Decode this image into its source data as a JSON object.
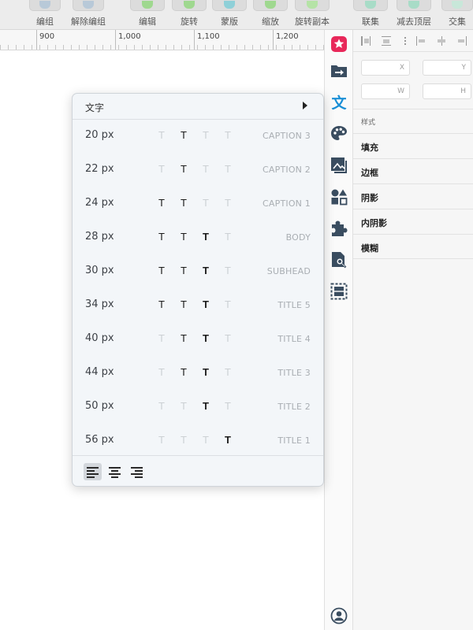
{
  "toolbar": {
    "buttons": [
      {
        "label": "编组",
        "icon": "group-icon"
      },
      {
        "label": "解除编组",
        "icon": "ungroup-icon"
      },
      {
        "label": "编辑",
        "icon": "edit-icon"
      },
      {
        "label": "旋转",
        "icon": "rotate-icon"
      },
      {
        "label": "蒙版",
        "icon": "mask-icon"
      },
      {
        "label": "缩放",
        "icon": "scale-icon"
      },
      {
        "label": "旋转副本",
        "icon": "rotate-copy-icon"
      },
      {
        "label": "联集",
        "icon": "union-icon"
      },
      {
        "label": "减去顶层",
        "icon": "subtract-icon"
      },
      {
        "label": "交集",
        "icon": "intersect-icon"
      }
    ]
  },
  "ruler": {
    "labels": [
      "900",
      "1,000",
      "1,100",
      "1,200"
    ]
  },
  "rail": {
    "icons": [
      "star-badge-icon",
      "folder-arrow-icon",
      "text-wen-icon",
      "palette-icon",
      "image-layers-icon",
      "shapes-icon",
      "puzzle-icon",
      "document-search-icon",
      "selection-frame-icon",
      "user-avatar-icon"
    ],
    "text_icon_glyph": "文"
  },
  "inspector": {
    "fields": {
      "x": "X",
      "y": "Y",
      "w": "W",
      "h": "H"
    },
    "style_label": "样式",
    "sections": [
      "填充",
      "边框",
      "阴影",
      "内阴影",
      "模糊"
    ]
  },
  "popup": {
    "title": "文字",
    "glyph": "T",
    "rows": [
      {
        "size": "20 px",
        "name": "CAPTION 3",
        "weights": [
          false,
          true,
          false,
          false
        ]
      },
      {
        "size": "22 px",
        "name": "CAPTION 2",
        "weights": [
          false,
          true,
          false,
          false
        ]
      },
      {
        "size": "24 px",
        "name": "CAPTION 1",
        "weights": [
          true,
          true,
          false,
          false
        ]
      },
      {
        "size": "28 px",
        "name": "BODY",
        "weights": [
          true,
          true,
          true,
          false
        ]
      },
      {
        "size": "30 px",
        "name": "SUBHEAD",
        "weights": [
          true,
          true,
          true,
          false
        ]
      },
      {
        "size": "34 px",
        "name": "TITLE 5",
        "weights": [
          true,
          true,
          true,
          false
        ]
      },
      {
        "size": "40 px",
        "name": "TITLE 4",
        "weights": [
          false,
          true,
          true,
          false
        ]
      },
      {
        "size": "44 px",
        "name": "TITLE 3",
        "weights": [
          false,
          true,
          true,
          false
        ]
      },
      {
        "size": "50 px",
        "name": "TITLE 2",
        "weights": [
          false,
          false,
          true,
          false
        ]
      },
      {
        "size": "56 px",
        "name": "TITLE 1",
        "weights": [
          false,
          false,
          false,
          true
        ]
      }
    ],
    "alignment": {
      "options": [
        "align-left-icon",
        "align-center-icon",
        "align-right-icon"
      ],
      "selected": "align-left-icon"
    }
  }
}
